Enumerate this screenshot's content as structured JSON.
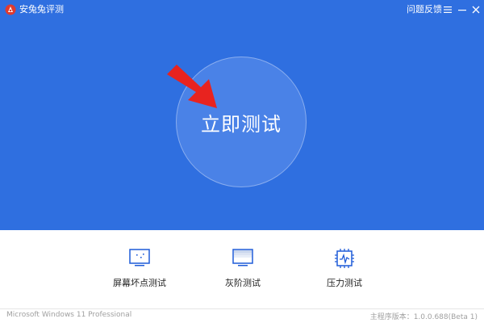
{
  "app": {
    "title": "安兔兔评测",
    "feedback_label": "问题反馈"
  },
  "hero": {
    "start_button_label": "立即测试"
  },
  "tools": [
    {
      "label": "屏幕坏点测试",
      "icon": "monitor-icon"
    },
    {
      "label": "灰阶测试",
      "icon": "grayscale-monitor-icon"
    },
    {
      "label": "压力测试",
      "icon": "cpu-pulse-icon"
    }
  ],
  "status": {
    "os": "Microsoft Windows 11 Professional",
    "version": "主程序版本：1.0.0.688(Beta 1)"
  },
  "colors": {
    "primary_blue": "#2f6fe0",
    "circle_blue": "#4a82e7",
    "icon_blue": "#1e5bd8",
    "arrow_red": "#e8231f"
  }
}
